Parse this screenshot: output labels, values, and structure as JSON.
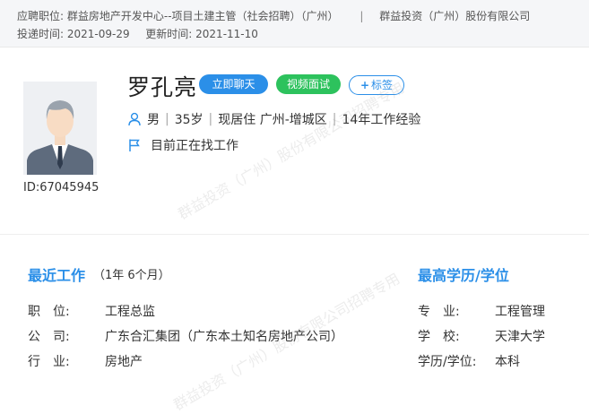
{
  "header": {
    "position_label": "应聘职位:",
    "position_value": "群益房地产开发中心--项目土建主管（社会招聘）（广州）",
    "separator": "|",
    "company": "群益投资（广州）股份有限公司",
    "submit_label": "投递时间:",
    "submit_date": "2021-09-29",
    "update_label": "更新时间:",
    "update_date": "2021-11-10"
  },
  "profile": {
    "name": "罗孔亮",
    "id": "ID:67045945",
    "chat_button": "立即聊天",
    "video_button": "视频面试",
    "tag_button": "标签",
    "gender": "男",
    "age": "35岁",
    "residence": "现居住 广州-增城区",
    "experience": "14年工作经验",
    "job_status": "目前正在找工作"
  },
  "recent_work": {
    "title": "最近工作",
    "duration": "（1年 6个月）",
    "rows": [
      {
        "label": "职　位:",
        "value": "工程总监"
      },
      {
        "label": "公　司:",
        "value": "广东合汇集团（广东本土知名房地产公司）"
      },
      {
        "label": "行　业:",
        "value": "房地产"
      }
    ]
  },
  "education": {
    "title": "最高学历/学位",
    "rows": [
      {
        "label": "专　业:",
        "value": "工程管理"
      },
      {
        "label": "学　校:",
        "value": "天津大学"
      },
      {
        "label": "学历/学位:",
        "value": "本科"
      }
    ]
  },
  "colors": {
    "accent": "#2b8fe8",
    "green": "#2dc25d"
  },
  "watermark": "群益投资（广州）股份有限公司招聘专用"
}
